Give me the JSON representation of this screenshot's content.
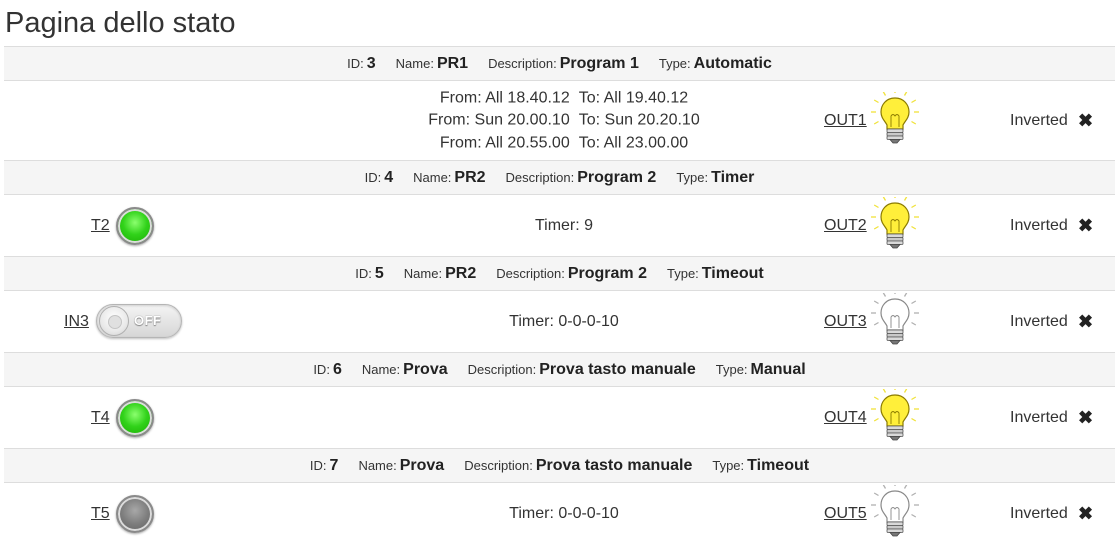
{
  "page": {
    "title": "Pagina dello stato"
  },
  "labels": {
    "id": "ID:",
    "name": "Name:",
    "description": "Description:",
    "type": "Type:",
    "from": "From:",
    "to": "To:",
    "timer": "Timer:",
    "inverted": "Inverted"
  },
  "colors": {
    "led_on": "#2fd01a",
    "led_off": "#7a7a7a",
    "bulb_on": "#ffef3a",
    "bulb_off": "#ffffff"
  },
  "programs": [
    {
      "id": "3",
      "name": "PR1",
      "description": "Program 1",
      "type": "Automatic",
      "input": null,
      "schedule": [
        {
          "from": "All 18.40.12",
          "to": "All 19.40.12"
        },
        {
          "from": "Sun 20.00.10",
          "to": "Sun 20.20.10"
        },
        {
          "from": "All 20.55.00",
          "to": "All 23.00.00"
        }
      ],
      "timer": null,
      "output": {
        "label": "OUT1",
        "on": true,
        "icon": "lightbulb-on-icon"
      },
      "inverted": "Inverted",
      "remove_icon": "close-icon"
    },
    {
      "id": "4",
      "name": "PR2",
      "description": "Program 2",
      "type": "Timer",
      "input": {
        "label": "T2",
        "kind": "led",
        "on": true,
        "icon": "led-green-icon"
      },
      "schedule": null,
      "timer": "9",
      "output": {
        "label": "OUT2",
        "on": true,
        "icon": "lightbulb-on-icon"
      },
      "inverted": "Inverted",
      "remove_icon": "close-icon"
    },
    {
      "id": "5",
      "name": "PR2",
      "description": "Program 2",
      "type": "Timeout",
      "input": {
        "label": "IN3",
        "kind": "switch",
        "on": false,
        "state_text": "OFF"
      },
      "schedule": null,
      "timer": "0-0-0-10",
      "output": {
        "label": "OUT3",
        "on": false,
        "icon": "lightbulb-off-icon"
      },
      "inverted": "Inverted",
      "remove_icon": "close-icon"
    },
    {
      "id": "6",
      "name": "Prova",
      "description": "Prova tasto manuale",
      "type": "Manual",
      "input": {
        "label": "T4",
        "kind": "led",
        "on": true,
        "icon": "led-green-icon"
      },
      "schedule": null,
      "timer": null,
      "output": {
        "label": "OUT4",
        "on": true,
        "icon": "lightbulb-on-icon"
      },
      "inverted": "Inverted",
      "remove_icon": "close-icon"
    },
    {
      "id": "7",
      "name": "Prova",
      "description": "Prova tasto manuale",
      "type": "Timeout",
      "input": {
        "label": "T5",
        "kind": "led",
        "on": false,
        "icon": "led-gray-icon"
      },
      "schedule": null,
      "timer": "0-0-0-10",
      "output": {
        "label": "OUT5",
        "on": false,
        "icon": "lightbulb-off-icon"
      },
      "inverted": "Inverted",
      "remove_icon": "close-icon"
    }
  ]
}
